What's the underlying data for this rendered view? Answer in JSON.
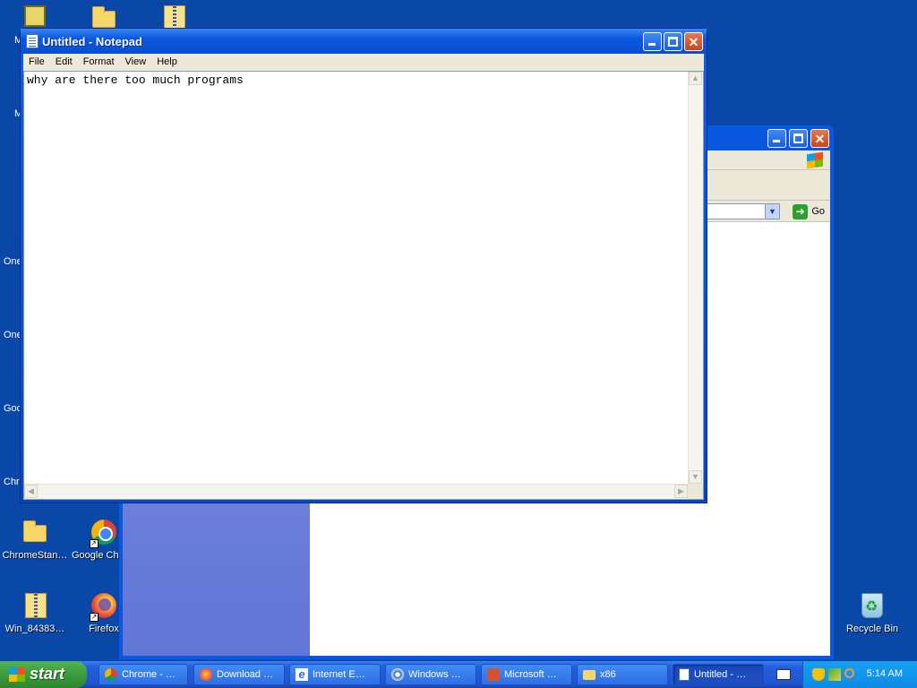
{
  "desktop": {
    "icons": [
      {
        "label": "M",
        "icon": "outlook-icon"
      },
      {
        "label": "M",
        "icon": "partial-icon"
      },
      {
        "label": "One",
        "icon": "partial-icon"
      },
      {
        "label": "One",
        "icon": "partial-icon"
      },
      {
        "label": "Goc",
        "icon": "partial-icon"
      },
      {
        "label": "Chro",
        "icon": "partial-icon"
      },
      {
        "label": "ChromeStan…",
        "icon": "folder-icon"
      },
      {
        "label": "Google Chr",
        "icon": "chrome-icon"
      },
      {
        "label": "Win_84383…",
        "icon": "zip-folder-icon"
      },
      {
        "label": "Firefox",
        "icon": "firefox-icon"
      },
      {
        "label": "Recycle Bin",
        "icon": "recycle-bin-icon"
      }
    ]
  },
  "explorer": {
    "go_label": "Go"
  },
  "notepad": {
    "title": "Untitled - Notepad",
    "menu": [
      "File",
      "Edit",
      "Format",
      "View",
      "Help"
    ],
    "content": "why are there too much programs"
  },
  "taskbar": {
    "start_label": "start",
    "buttons": [
      {
        "label": "Chrome - …",
        "icon": "chrome-icon"
      },
      {
        "label": "Download …",
        "icon": "firefox-icon"
      },
      {
        "label": "Internet E…",
        "icon": "ie-icon"
      },
      {
        "label": "Windows …",
        "icon": "media-icon"
      },
      {
        "label": "Microsoft …",
        "icon": "powerpoint-icon"
      },
      {
        "label": "x86",
        "icon": "folder-icon"
      },
      {
        "label": "Untitled - …",
        "icon": "notepad-icon",
        "active": true
      }
    ],
    "clock": "5:14 AM"
  }
}
